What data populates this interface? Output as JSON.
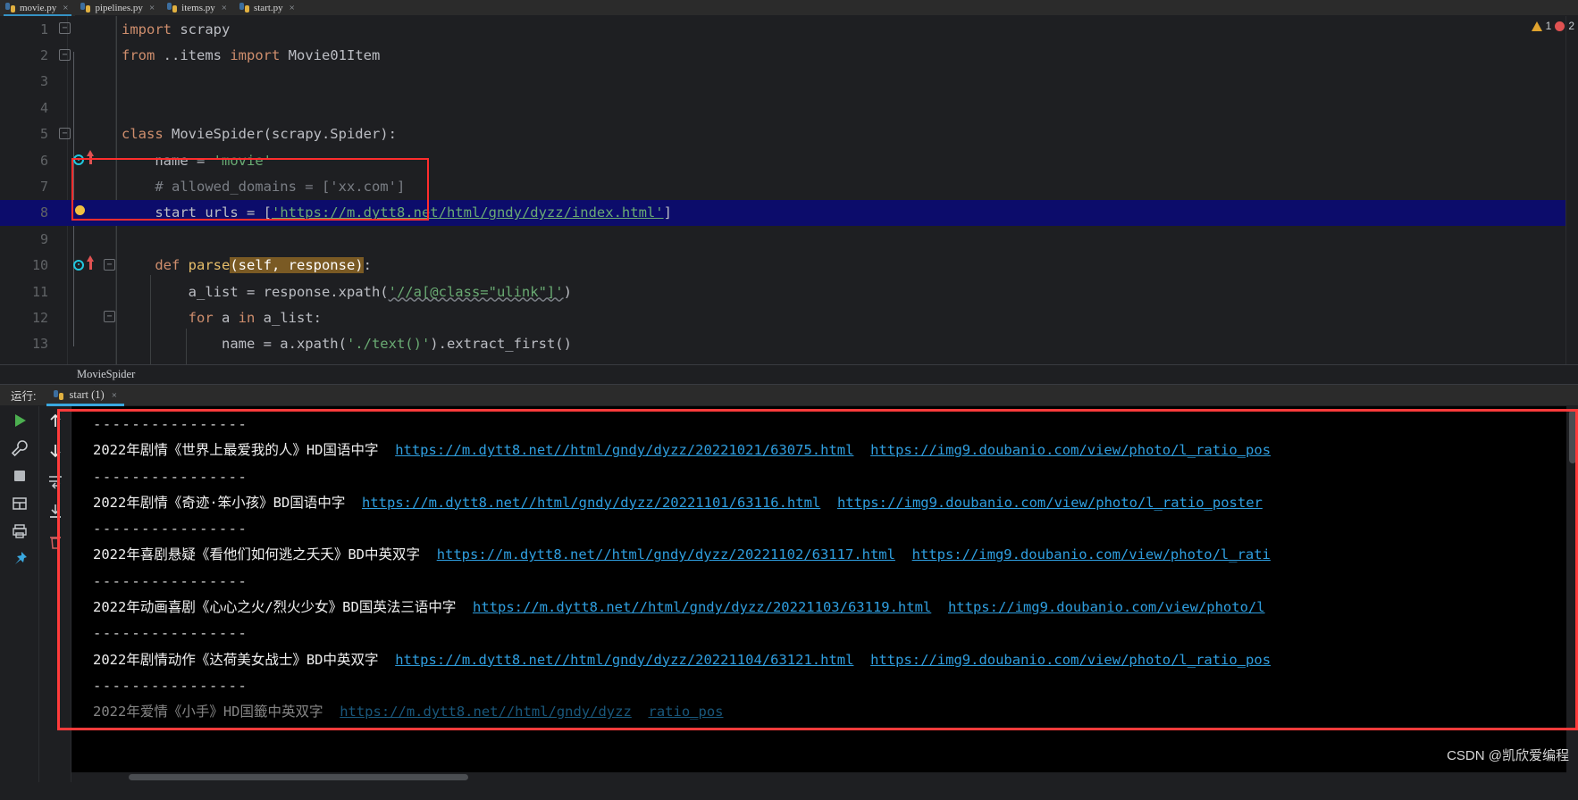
{
  "editor_tabs": [
    {
      "label": "movie.py",
      "icon": "python-file-icon",
      "active": true,
      "close": "×"
    },
    {
      "label": "pipelines.py",
      "icon": "python-file-icon",
      "active": false,
      "close": "×"
    },
    {
      "label": "items.py",
      "icon": "python-file-icon",
      "active": false,
      "close": "×"
    },
    {
      "label": "start.py",
      "icon": "python-file-icon",
      "active": false,
      "close": "×"
    }
  ],
  "inspection": {
    "warning_count": "1",
    "error_count": "2",
    "warning_icon": "warning-triangle-icon",
    "error_icon": "error-circle-icon"
  },
  "code_lines": [
    {
      "n": "1",
      "text": "import scrapy"
    },
    {
      "n": "2",
      "text": "from ..items import Movie01Item"
    },
    {
      "n": "3",
      "text": ""
    },
    {
      "n": "4",
      "text": ""
    },
    {
      "n": "5",
      "text": "class MovieSpider(scrapy.Spider):"
    },
    {
      "n": "6",
      "text": "    name = 'movie'"
    },
    {
      "n": "7",
      "text": "    # allowed_domains = ['xx.com']"
    },
    {
      "n": "8",
      "text": "    start_urls = ['https://m.dytt8.net/html/gndy/dyzz/index.html']"
    },
    {
      "n": "9",
      "text": ""
    },
    {
      "n": "10",
      "text": "    def parse(self, response):"
    },
    {
      "n": "11",
      "text": "        a_list = response.xpath('//a[@class=\"ulink\"]')"
    },
    {
      "n": "12",
      "text": "        for a in a_list:"
    },
    {
      "n": "13",
      "text": "            name = a.xpath('./text()').extract_first()"
    }
  ],
  "code_tokens": {
    "l1_kw": "import",
    "l1_rest": " scrapy",
    "l2_kw1": "from",
    "l2_mid": " ..items ",
    "l2_kw2": "import",
    "l2_rest": " Movie01Item",
    "l5_kw": "class",
    "l5_name": " MovieSpider",
    "l5_rest": "(scrapy.Spider):",
    "l6_name": "    name = ",
    "l6_str": "'movie'",
    "l7_comment": "    # allowed_domains = ['xx.com']",
    "l8_lhs": "    start_urls = [",
    "l8_url": "'https://m.dytt8.net/html/gndy/dyzz/index.html'",
    "l8_rhs": "]",
    "l10_kw": "    def ",
    "l10_fn": "parse",
    "l10_params": "(self, response)",
    "l10_rest": ":",
    "l11_lhs": "        a_list = response.xpath(",
    "l11_str": "'//a[@class=\"ulink\"]'",
    "l11_rhs": ")",
    "l12_kw1": "        for ",
    "l12_var": "a",
    "l12_kw2": " in ",
    "l12_rest": "a_list:",
    "l13_lhs": "            name = a.xpath(",
    "l13_str": "'./text()'",
    "l13_rhs": ").extract_first()"
  },
  "breadcrumb": {
    "text": "MovieSpider"
  },
  "run_panel": {
    "label": "运行:",
    "tab": {
      "label": "start (1)",
      "icon": "python-file-icon",
      "close": "×"
    },
    "toolbar": [
      {
        "name": "run-button",
        "glyph": "▶"
      },
      {
        "name": "wrench-settings-button",
        "glyph": "ᵨ"
      },
      {
        "name": "stop-button",
        "glyph": "■"
      },
      {
        "name": "layout-button",
        "glyph": "▦"
      },
      {
        "name": "print-button",
        "glyph": "⎙"
      },
      {
        "name": "pin-button",
        "glyph": "✒"
      }
    ],
    "toolbar2": [
      {
        "name": "scroll-up-button",
        "glyph": "↑"
      },
      {
        "name": "scroll-down-button",
        "glyph": "↓"
      },
      {
        "name": "soft-wrap-button",
        "glyph": "↵"
      },
      {
        "name": "scroll-to-end-button",
        "glyph": "↧"
      },
      {
        "name": "clear-all-button",
        "glyph": "🗑"
      }
    ]
  },
  "console_output": [
    {
      "type": "separator",
      "text": "----------------"
    },
    {
      "type": "item",
      "title": "2022年剧情《世界上最爱我的人》HD国语中字",
      "url1": "https://m.dytt8.net//html/gndy/dyzz/20221021/63075.html",
      "url2": "https://img9.doubanio.com/view/photo/l_ratio_pos"
    },
    {
      "type": "separator",
      "text": "----------------"
    },
    {
      "type": "item",
      "title": "2022年剧情《奇迹·笨小孩》BD国语中字",
      "url1": "https://m.dytt8.net//html/gndy/dyzz/20221101/63116.html",
      "url2": "https://img9.doubanio.com/view/photo/l_ratio_poster"
    },
    {
      "type": "separator",
      "text": "----------------"
    },
    {
      "type": "item",
      "title": "2022年喜剧悬疑《看他们如何逃之夭夭》BD中英双字",
      "url1": "https://m.dytt8.net//html/gndy/dyzz/20221102/63117.html",
      "url2": "https://img9.doubanio.com/view/photo/l_rati"
    },
    {
      "type": "separator",
      "text": "----------------"
    },
    {
      "type": "item",
      "title": "2022年动画喜剧《心心之火/烈火少女》BD国英法三语中字",
      "url1": "https://m.dytt8.net//html/gndy/dyzz/20221103/63119.html",
      "url2": "https://img9.doubanio.com/view/photo/l"
    },
    {
      "type": "separator",
      "text": "----------------"
    },
    {
      "type": "item",
      "title": "2022年剧情动作《达荷美女战士》BD中英双字",
      "url1": "https://m.dytt8.net//html/gndy/dyzz/20221104/63121.html",
      "url2": "https://img9.doubanio.com/view/photo/l_ratio_pos"
    },
    {
      "type": "separator",
      "text": "----------------"
    },
    {
      "type": "item_partial",
      "title": "2022年爱情《小手》HD国籤中英双字",
      "url1": "https://m.dytt8.net//html/gndy/dyzz",
      "url2": "ratio_pos"
    }
  ],
  "watermark": {
    "text": "CSDN @凯欣爱编程"
  },
  "colors": {
    "accent": "#3592c4",
    "annotation_red": "#ff3b3b",
    "link_blue": "#2f9fe0",
    "keyword_orange": "#cf8e6d",
    "string_green": "#6aab73",
    "selection_blue": "#0c0c6b"
  }
}
